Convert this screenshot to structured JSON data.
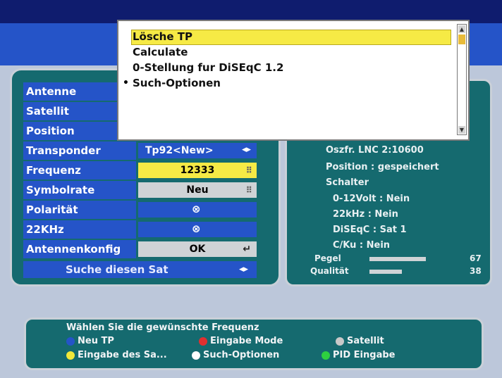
{
  "popup_menu": {
    "items": [
      "Lösche TP",
      "Calculate",
      "0-Stellung fur DiSEqC 1.2",
      "Such-Optionen"
    ],
    "selected_index": 0,
    "bullet": "•"
  },
  "settings": {
    "rows": [
      {
        "label": "Antenne"
      },
      {
        "label": "Satellit"
      },
      {
        "label": "Position"
      },
      {
        "label": "Transponder",
        "value": "Tp92<New>"
      },
      {
        "label": "Frequenz",
        "value": "12333"
      },
      {
        "label": "Symbolrate",
        "value": "Neu"
      },
      {
        "label": "Polarität"
      },
      {
        "label": "22KHz"
      },
      {
        "label": "Antennenkonfig",
        "value": "OK"
      }
    ],
    "search_label": "Suche diesen Sat"
  },
  "info": {
    "lnc": "Oszfr. LNC 2:10600",
    "position": "Position : gespeichert",
    "schalter": "Schalter",
    "volt": "0-12Volt : Nein",
    "khz": "22kHz : Nein",
    "diseqc": "DiSEqC : Sat 1",
    "cku": "C/Ku : Nein",
    "pegel_label": "Pegel",
    "pegel_value": "67",
    "qualitaet_label": "Qualität",
    "qualitaet_value": "38",
    "pegel_fraction": 0.67,
    "qualitaet_fraction": 0.38
  },
  "footer": {
    "hint": "Wählen Sie die gewünschte Frequenz",
    "neu_tp": "Neu TP",
    "eingabe_mode": "Eingabe Mode",
    "satellit": "Satellit",
    "eingabe_sa": "Eingabe des Sa...",
    "such_optionen": "Such-Optionen",
    "pid_eingabe": "PID Eingabe"
  },
  "colors": {
    "blue": "#2554c8",
    "teal": "#156a6f",
    "highlight": "#f6ea45",
    "red": "#e03030",
    "green": "#2ed040",
    "yellow": "#f2e83a",
    "gray": "#c8c8c8",
    "white": "#ffffff"
  }
}
